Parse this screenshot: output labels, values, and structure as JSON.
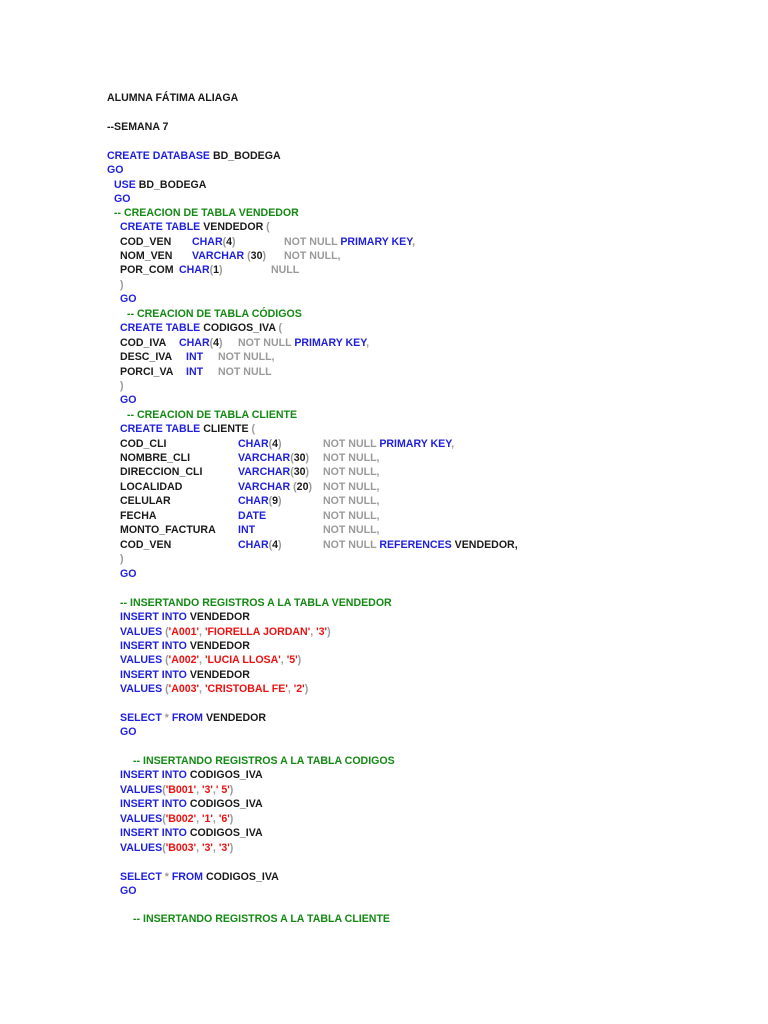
{
  "document": {
    "colors": {
      "keyword": "#1f1fe0",
      "text": "#1a1a1a",
      "comment": "#138a13",
      "gray": "#9a9a9a",
      "string": "#ee1111"
    },
    "lines": [
      [
        [
          [
            "t",
            "ALUMNA FÁTIMA ALIAGA"
          ]
        ]
      ],
      [
        [
          [
            "t",
            "--SEMANA 7"
          ]
        ]
      ],
      [
        [
          [
            "k",
            "CREATE DATABASE "
          ],
          [
            "t",
            "BD_BODEGA"
          ]
        ]
      ],
      [
        [
          [
            "k",
            "GO"
          ]
        ]
      ],
      [
        [
          [
            "k",
            "USE "
          ],
          [
            "t",
            "BD_BODEGA"
          ]
        ]
      ],
      [
        [
          [
            "k",
            "GO"
          ]
        ]
      ],
      [
        [
          [
            "c",
            "-- CREACION DE TABLA VENDEDOR"
          ]
        ]
      ],
      [
        [
          [
            "k",
            "CREATE TABLE "
          ],
          [
            "t",
            "VENDEDOR "
          ],
          [
            "g",
            "("
          ]
        ]
      ],
      [
        [
          [
            "t",
            "COD_VEN"
          ]
        ],
        [
          [
            "k",
            "CHAR"
          ],
          [
            "g",
            "("
          ],
          [
            "t",
            "4"
          ],
          [
            "g",
            ")"
          ]
        ],
        [
          [
            "g",
            "NOT NULL "
          ],
          [
            "k",
            "PRIMARY KEY"
          ],
          [
            "g",
            ","
          ]
        ]
      ],
      [
        [
          [
            "t",
            "NOM_VEN"
          ]
        ],
        [
          [
            "k",
            "VARCHAR "
          ],
          [
            "g",
            "("
          ],
          [
            "t",
            "30"
          ],
          [
            "g",
            ")"
          ]
        ],
        [
          [
            "g",
            "NOT NULL,"
          ]
        ]
      ],
      [
        [
          [
            "t",
            "POR_COM"
          ]
        ],
        [
          [
            "k",
            "CHAR"
          ],
          [
            "g",
            "("
          ],
          [
            "t",
            "1"
          ],
          [
            "g",
            ")"
          ]
        ],
        [
          [
            "g",
            "NULL"
          ]
        ]
      ],
      [
        [
          [
            "g",
            ")"
          ]
        ]
      ],
      [
        [
          [
            "k",
            "GO"
          ]
        ]
      ],
      [
        [
          [
            "c",
            "-- CREACION DE TABLA CÓDIGOS"
          ]
        ]
      ],
      [
        [
          [
            "k",
            "CREATE TABLE "
          ],
          [
            "t",
            "CODIGOS_IVA "
          ],
          [
            "g",
            "("
          ]
        ]
      ],
      [
        [
          [
            "t",
            "COD_IVA"
          ]
        ],
        [
          [
            "k",
            "CHAR"
          ],
          [
            "g",
            "("
          ],
          [
            "t",
            "4"
          ],
          [
            "g",
            ")"
          ]
        ],
        [
          [
            "g",
            "NOT NULL "
          ],
          [
            "k",
            "PRIMARY KEY"
          ],
          [
            "g",
            ","
          ]
        ]
      ],
      [
        [
          [
            "t",
            "DESC_IVA"
          ]
        ],
        [
          [
            "k",
            "INT"
          ]
        ],
        [
          [
            "g",
            "NOT NULL,"
          ]
        ]
      ],
      [
        [
          [
            "t",
            "PORCI_VA"
          ]
        ],
        [
          [
            "k",
            "INT"
          ]
        ],
        [
          [
            "g",
            "NOT NULL"
          ]
        ]
      ],
      [
        [
          [
            "g",
            ")"
          ]
        ]
      ],
      [
        [
          [
            "k",
            "GO"
          ]
        ]
      ],
      [
        [
          [
            "c",
            "-- CREACION DE TABLA CLIENTE"
          ]
        ]
      ],
      [
        [
          [
            "k",
            "CREATE TABLE "
          ],
          [
            "t",
            "CLIENTE "
          ],
          [
            "g",
            "("
          ]
        ]
      ],
      [
        [
          [
            "t",
            "COD_CLI"
          ]
        ],
        [
          [
            "k",
            "CHAR"
          ],
          [
            "g",
            "("
          ],
          [
            "t",
            "4"
          ],
          [
            "g",
            ")"
          ]
        ],
        [
          [
            "g",
            "NOT NULL "
          ],
          [
            "k",
            "PRIMARY KEY"
          ],
          [
            "g",
            ","
          ]
        ]
      ],
      [
        [
          [
            "t",
            "NOMBRE_CLI"
          ]
        ],
        [
          [
            "k",
            "VARCHAR"
          ],
          [
            "g",
            "("
          ],
          [
            "t",
            "30"
          ],
          [
            "g",
            ")"
          ]
        ],
        [
          [
            "g",
            "NOT NULL,"
          ]
        ]
      ],
      [
        [
          [
            "t",
            "DIRECCION_CLI"
          ]
        ],
        [
          [
            "k",
            "VARCHAR"
          ],
          [
            "g",
            "("
          ],
          [
            "t",
            "30"
          ],
          [
            "g",
            ")"
          ]
        ],
        [
          [
            "g",
            "NOT NULL,"
          ]
        ]
      ],
      [
        [
          [
            "t",
            "LOCALIDAD"
          ]
        ],
        [
          [
            "k",
            "VARCHAR "
          ],
          [
            "g",
            "("
          ],
          [
            "t",
            "20"
          ],
          [
            "g",
            ")"
          ]
        ],
        [
          [
            "g",
            "NOT NULL,"
          ]
        ]
      ],
      [
        [
          [
            "t",
            "CELULAR"
          ]
        ],
        [
          [
            "k",
            "CHAR"
          ],
          [
            "g",
            "("
          ],
          [
            "t",
            "9"
          ],
          [
            "g",
            ")"
          ]
        ],
        [
          [
            "g",
            "NOT NULL,"
          ]
        ]
      ],
      [
        [
          [
            "t",
            "FECHA"
          ]
        ],
        [
          [
            "k",
            "DATE"
          ]
        ],
        [
          [
            "g",
            "NOT NULL,"
          ]
        ]
      ],
      [
        [
          [
            "t",
            "MONTO_FACTURA"
          ]
        ],
        [
          [
            "k",
            "INT"
          ]
        ],
        [
          [
            "g",
            "NOT NULL,"
          ]
        ]
      ],
      [
        [
          [
            "t",
            "COD_VEN"
          ]
        ],
        [
          [
            "k",
            "CHAR"
          ],
          [
            "g",
            "("
          ],
          [
            "t",
            "4"
          ],
          [
            "g",
            ")"
          ]
        ],
        [
          [
            "g",
            "NOT NULL "
          ],
          [
            "k",
            "REFERENCES "
          ],
          [
            "t",
            "VENDEDOR,"
          ]
        ]
      ],
      [
        [
          [
            "g",
            ")"
          ]
        ]
      ],
      [
        [
          [
            "k",
            "GO"
          ]
        ]
      ],
      [
        [
          [
            "c",
            "-- INSERTANDO REGISTROS A LA TABLA VENDEDOR"
          ]
        ]
      ],
      [
        [
          [
            "k",
            "INSERT INTO "
          ],
          [
            "t",
            "VENDEDOR"
          ]
        ]
      ],
      [
        [
          [
            "k",
            "VALUES "
          ],
          [
            "g",
            "("
          ],
          [
            "s",
            "'A001'"
          ],
          [
            "g",
            ", "
          ],
          [
            "s",
            "'FIORELLA JORDAN'"
          ],
          [
            "g",
            ", "
          ],
          [
            "s",
            "'3'"
          ],
          [
            "g",
            ")"
          ]
        ]
      ],
      [
        [
          [
            "k",
            "INSERT INTO "
          ],
          [
            "t",
            "VENDEDOR"
          ]
        ]
      ],
      [
        [
          [
            "k",
            "VALUES "
          ],
          [
            "g",
            "("
          ],
          [
            "s",
            "'A002'"
          ],
          [
            "g",
            ", "
          ],
          [
            "s",
            "'LUCIA LLOSA'"
          ],
          [
            "g",
            ", "
          ],
          [
            "s",
            "'5'"
          ],
          [
            "g",
            ")"
          ]
        ]
      ],
      [
        [
          [
            "k",
            "INSERT INTO "
          ],
          [
            "t",
            "VENDEDOR"
          ]
        ]
      ],
      [
        [
          [
            "k",
            "VALUES "
          ],
          [
            "g",
            "("
          ],
          [
            "s",
            "'A003'"
          ],
          [
            "g",
            ", "
          ],
          [
            "s",
            "'CRISTOBAL FE'"
          ],
          [
            "g",
            ", "
          ],
          [
            "s",
            "'2'"
          ],
          [
            "g",
            ")"
          ]
        ]
      ],
      [
        [
          [
            "k",
            "SELECT "
          ],
          [
            "g",
            "* "
          ],
          [
            "k",
            "FROM "
          ],
          [
            "t",
            "VENDEDOR"
          ]
        ]
      ],
      [
        [
          [
            "k",
            "GO"
          ]
        ]
      ],
      [
        [
          [
            "c",
            "-- INSERTANDO REGISTROS A LA TABLA CODIGOS"
          ]
        ]
      ],
      [
        [
          [
            "k",
            "INSERT INTO "
          ],
          [
            "t",
            "CODIGOS_IVA"
          ]
        ]
      ],
      [
        [
          [
            "k",
            "VALUES"
          ],
          [
            "g",
            "("
          ],
          [
            "s",
            "'B001'"
          ],
          [
            "g",
            ", "
          ],
          [
            "s",
            "'3'"
          ],
          [
            "g",
            ","
          ],
          [
            "s",
            "' 5'"
          ],
          [
            "g",
            ")"
          ]
        ]
      ],
      [
        [
          [
            "k",
            "INSERT INTO "
          ],
          [
            "t",
            "CODIGOS_IVA"
          ]
        ]
      ],
      [
        [
          [
            "k",
            "VALUES"
          ],
          [
            "g",
            "("
          ],
          [
            "s",
            "'B002'"
          ],
          [
            "g",
            ", "
          ],
          [
            "s",
            "'1'"
          ],
          [
            "g",
            ", "
          ],
          [
            "s",
            "'6'"
          ],
          [
            "g",
            ")"
          ]
        ]
      ],
      [
        [
          [
            "k",
            "INSERT INTO "
          ],
          [
            "t",
            "CODIGOS_IVA"
          ]
        ]
      ],
      [
        [
          [
            "k",
            "VALUES"
          ],
          [
            "g",
            "("
          ],
          [
            "s",
            "'B003'"
          ],
          [
            "g",
            ", "
          ],
          [
            "s",
            "'3'"
          ],
          [
            "g",
            ", "
          ],
          [
            "s",
            "'3'"
          ],
          [
            "g",
            ")"
          ]
        ]
      ],
      [
        [
          [
            "k",
            "SELECT "
          ],
          [
            "g",
            "* "
          ],
          [
            "k",
            "FROM "
          ],
          [
            "t",
            "CODIGOS_IVA"
          ]
        ]
      ],
      [
        [
          [
            "k",
            "GO"
          ]
        ]
      ],
      [
        [
          [
            "c",
            "-- INSERTANDO REGISTROS A LA TABLA CLIENTE"
          ]
        ]
      ]
    ]
  }
}
